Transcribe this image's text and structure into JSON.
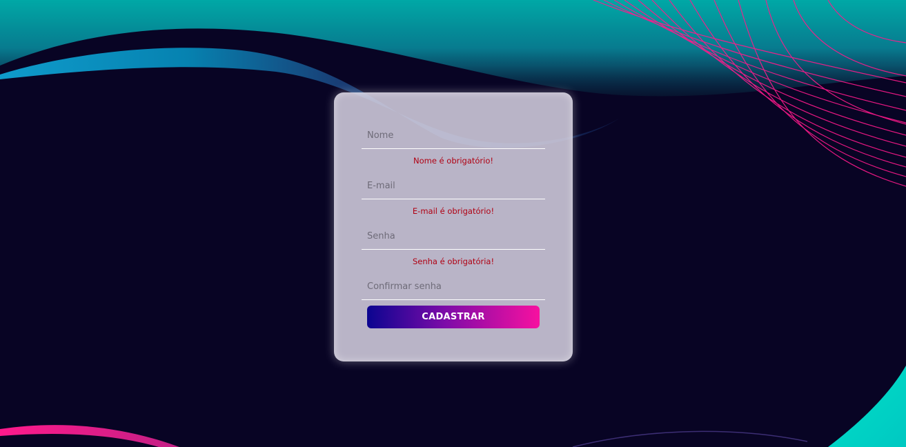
{
  "form": {
    "fields": [
      {
        "placeholder": "Nome",
        "value": "",
        "error": "Nome é obrigatório!"
      },
      {
        "placeholder": "E-mail",
        "value": "",
        "error": "E-mail é obrigatório!"
      },
      {
        "placeholder": "Senha",
        "value": "",
        "error": "Senha é obrigatória!"
      },
      {
        "placeholder": "Confirmar senha",
        "value": ""
      }
    ],
    "submit_label": "CADASTRAR"
  },
  "colors": {
    "error_text": "#b00012",
    "button_gradient_start": "#0b0590",
    "button_gradient_end": "#f711a0",
    "background_dark": "#0c0628",
    "accent_teal": "#00b7b0",
    "accent_pink": "#ff1a8c"
  }
}
